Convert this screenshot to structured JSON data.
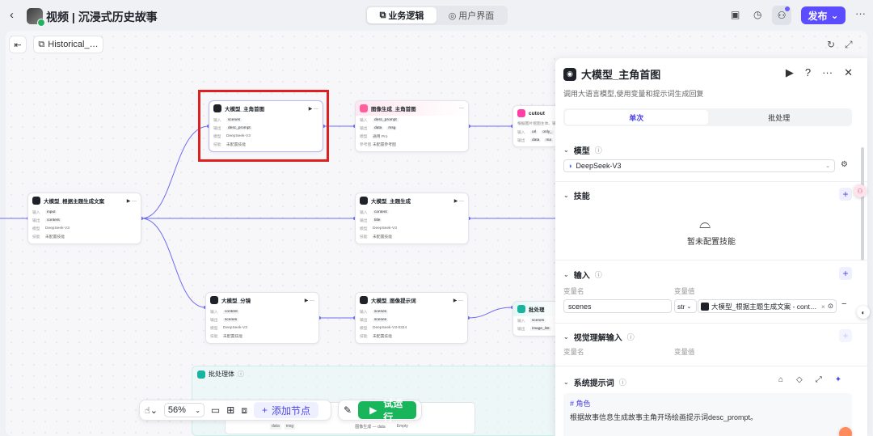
{
  "topbar": {
    "back_icon": "chevron-left-icon",
    "app_title": "视频 | 沉浸式历史故事",
    "tabs": [
      {
        "label": "业务逻辑",
        "icon": "flow-icon",
        "active": true
      },
      {
        "label": "用户界面",
        "icon": "palette-icon",
        "active": false
      }
    ],
    "publish_label": "发布",
    "accent": "#5b4cff"
  },
  "canvas": {
    "workflow_name": "Historical_…",
    "zoom": "56%",
    "add_node_label": "添加节点",
    "run_label": "试运行",
    "batch_group_title": "批处理体"
  },
  "nodes": {
    "n_copy": {
      "title": "大模型_根据主题生成文案",
      "input_label": "输入",
      "input": "input",
      "output_label": "输出",
      "output": "content",
      "model_label": "模型",
      "model": "DeepSeek-V3",
      "skill_label": "技能",
      "skill": "未配置技能"
    },
    "n_hero": {
      "title": "大模型_主角首图",
      "input_label": "输入",
      "input": "scenes",
      "output_label": "输出",
      "output": "desc_prompt",
      "model_label": "模型",
      "model": "DeepSeek-V3",
      "skill_label": "技能",
      "skill": "未配置技能"
    },
    "n_img": {
      "title": "图像生成_主角首图",
      "input_label": "输入",
      "input": "desc_prompt",
      "output_label": "输出",
      "output1": "data",
      "output2": "msg",
      "model_label": "模型",
      "model": "通用 Pro",
      "ref_label": "参考图",
      "ref": "未配置参考图"
    },
    "n_cutout": {
      "title": "cutout",
      "desc": "根据图片抠图主体、输出…",
      "input_label": "输入",
      "input1": "url",
      "input2": "only_",
      "output_label": "输出",
      "output1": "data",
      "output2": "ma"
    },
    "n_theme": {
      "title": "大模型_主题生成",
      "input_label": "输入",
      "input": "content",
      "output_label": "输出",
      "output": "title",
      "model_label": "模型",
      "model": "DeepSeek-V3",
      "skill_label": "技能",
      "skill": "未配置技能"
    },
    "n_storyboard": {
      "title": "大模型_分镜",
      "input_label": "输入",
      "input": "content",
      "output_label": "输出",
      "output": "scenes",
      "model_label": "模型",
      "model": "DeepSeek-V3",
      "skill_label": "技能",
      "skill": "未配置技能"
    },
    "n_imgprompt": {
      "title": "大模型_图像提示词",
      "input_label": "输入",
      "input": "scenes",
      "output_label": "输出",
      "output": "scenes",
      "model_label": "模型",
      "model": "DeepSeek-V3-0324",
      "skill_label": "技能",
      "skill": "未配置技能"
    },
    "n_batch": {
      "title": "批处理",
      "input_label": "输入",
      "input": "scenes",
      "output_label": "输出",
      "output": "image_list"
    },
    "n_bottom": {
      "output1": "data",
      "output2": "msg",
      "col": "图像生成 — data",
      "empty": "Empty"
    }
  },
  "panel": {
    "title": "大模型_主角首图",
    "description": "调用大语言模型,使用变量和提示词生成回复",
    "tabs": [
      {
        "label": "单次",
        "active": true
      },
      {
        "label": "批处理",
        "active": false
      }
    ],
    "model_section": "模型",
    "model_value": "DeepSeek-V3",
    "skills_section": "技能",
    "skills_empty": "暂未配置技能",
    "input_section": "输入",
    "var_name_label": "变量名",
    "var_value_label": "变量值",
    "var_name": "scenes",
    "var_type": "str",
    "var_ref": "大模型_根据主题生成文案 - cont…",
    "vision_section": "视觉理解输入",
    "vision_var_name_label": "变量名",
    "vision_var_value_label": "变量值",
    "system_prompt_section": "系统提示词",
    "prompt_heading": "# 角色",
    "prompt_text": "根据故事信息生成故事主角开场绘画提示词desc_prompt。"
  }
}
